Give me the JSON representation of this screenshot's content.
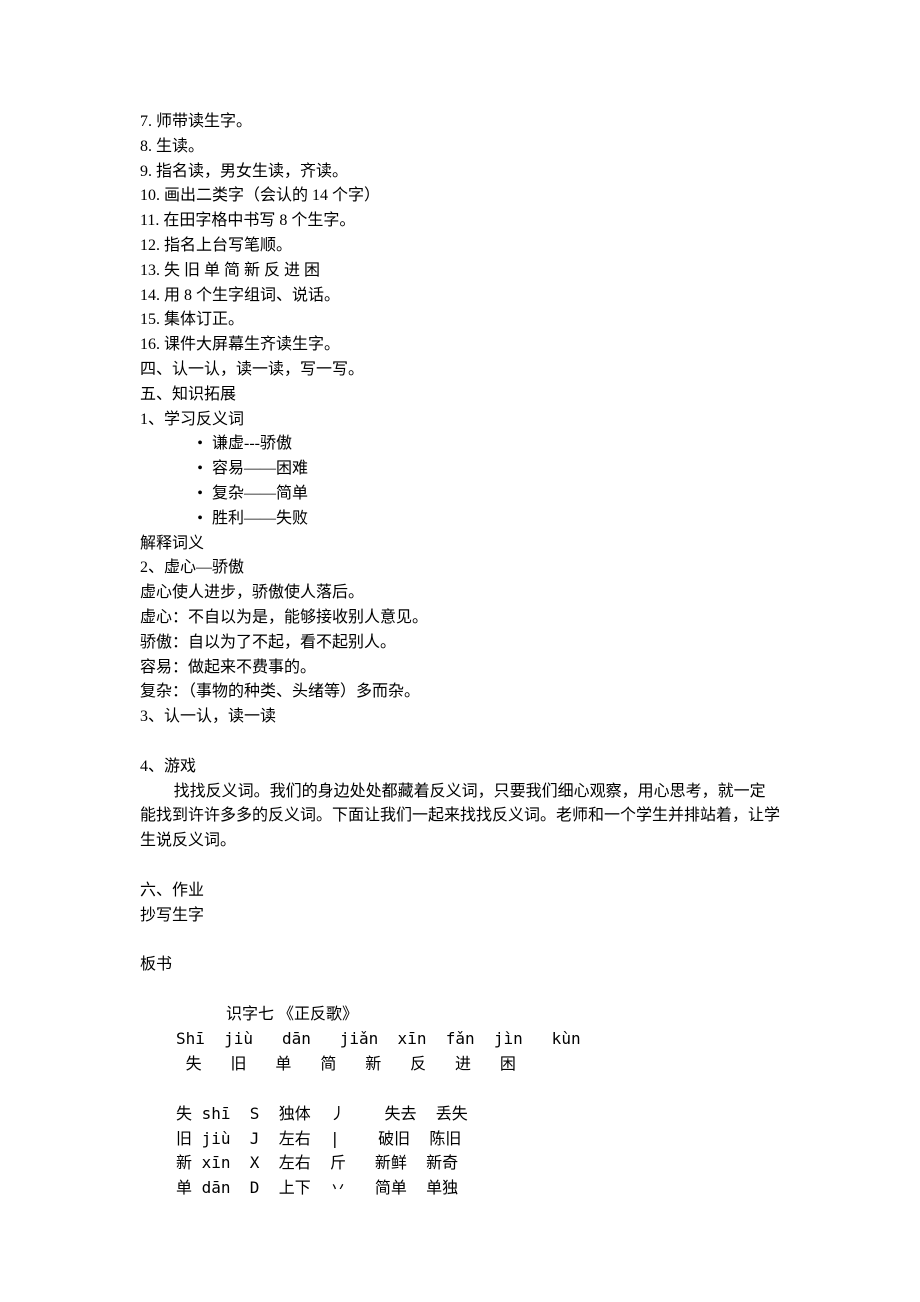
{
  "list1": [
    {
      "n": "7. ",
      "t": "师带读生字。"
    },
    {
      "n": "8. ",
      "t": "生读。"
    },
    {
      "n": "9. ",
      "t": "指名读，男女生读，齐读。"
    },
    {
      "n": "10. ",
      "t": "画出二类字（会认的 14 个字）"
    },
    {
      "n": "11. ",
      "t": "在田字格中书写 8 个生字。"
    },
    {
      "n": "12. ",
      "t": "指名上台写笔顺。"
    },
    {
      "n": "13. ",
      "t": "失  旧   单   简   新   反    进   困"
    },
    {
      "n": "14. ",
      "t": "用 8 个生字组词、说话。"
    },
    {
      "n": "15. ",
      "t": "集体订正。"
    },
    {
      "n": "16. ",
      "t": "课件大屏幕生齐读生字。"
    }
  ],
  "sec4": "四、认一认，读一读，写一写。",
  "sec5": "五、知识拓展",
  "item1": "1、学习反义词",
  "antonyms": [
    "谦虚---骄傲",
    "容易——困难",
    "复杂——简单",
    "胜利——失败"
  ],
  "explain": "解释词义",
  "item2": "2、虚心—骄傲",
  "defs": [
    "虚心使人进步，骄傲使人落后。",
    "虚心：不自以为是，能够接收别人意见。",
    "骄傲：自以为了不起，看不起别人。",
    "容易：做起来不费事的。",
    "复杂：（事物的种类、头绪等）多而杂。"
  ],
  "item3": "3、认一认，读一读",
  "item4": "4、游戏",
  "game": "找找反义词。我们的身边处处都藏着反义词，只要我们细心观察，用心思考，就一定能找到许许多多的反义词。下面让我们一起来找找反义词。老师和一个学生并排站着，让学生说反义词。",
  "sec6": "六、作业",
  "hw": "抄写生字",
  "boardLabel": "板书",
  "boardTitle": "识字七    《正反歌》",
  "pinyinRow": "Shī  jiù   dān   jiǎn  xīn  fǎn  jìn   kùn",
  "charRow": " 失   旧   单   简   新   反   进   困",
  "tbl": [
    "失 shī  S  独体  丿    失去  丢失",
    "旧 jiù  J  左右  |    破旧  陈旧",
    "新 xīn  X  左右  斤   新鲜  新奇",
    "单 dān  D  上下  丷   简单  单独"
  ]
}
